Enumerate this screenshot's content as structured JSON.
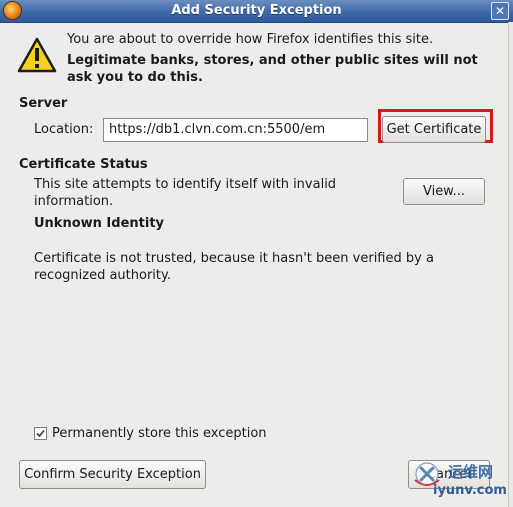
{
  "window": {
    "title": "Add Security Exception",
    "close_glyph": "✕"
  },
  "warning": {
    "icon": "warning-icon",
    "line1": "You are about to override how Firefox identifies this site.",
    "line2": "Legitimate banks, stores, and other public sites will not",
    "line3": "ask you to do this."
  },
  "server": {
    "heading": "Server",
    "location_label": "Location:",
    "location_value": "https://db1.clvn.com.cn:5500/em",
    "get_certificate_label": "Get Certificate"
  },
  "certificate_status": {
    "heading": "Certificate Status",
    "line1": "This site attempts to identify itself with invalid",
    "line2": "information.",
    "view_button_label": "View...",
    "identity_heading": "Unknown Identity",
    "detail_line1": "Certificate is not trusted, because it hasn't been verified by a",
    "detail_line2": "recognized authority."
  },
  "options": {
    "permanent_store_label": "Permanently store this exception",
    "permanent_store_checked": true
  },
  "footer": {
    "confirm_label": "Confirm Security Exception",
    "cancel_label": "Cancel"
  },
  "watermark": {
    "text1": "运维网",
    "text2": "iyunv.com"
  },
  "colors": {
    "titlebar": "#3e69a8",
    "highlight": "#d21a20",
    "background": "#edeceb"
  }
}
